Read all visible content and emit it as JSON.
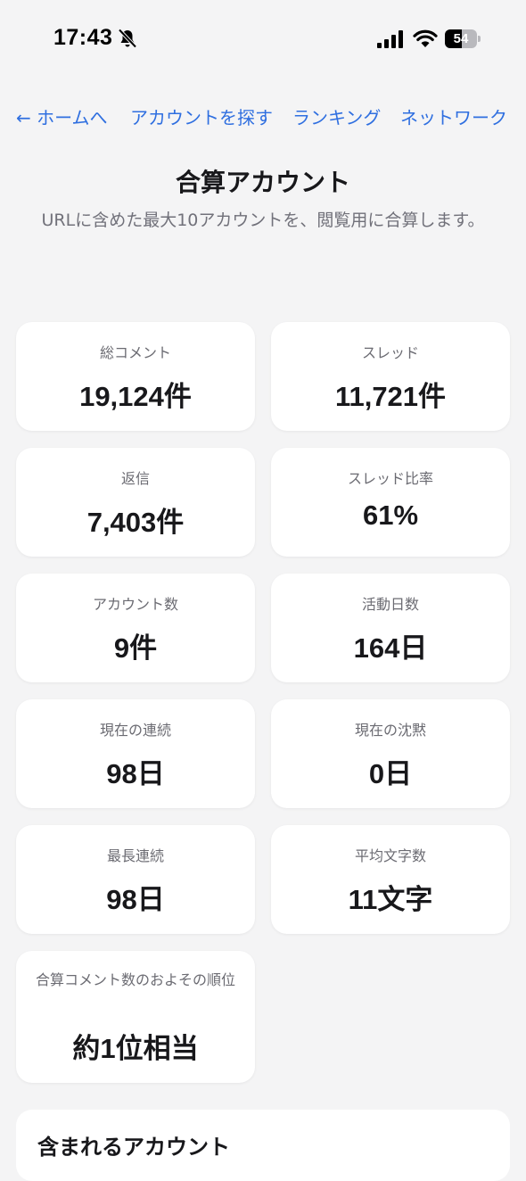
{
  "status": {
    "time": "17:43",
    "battery_level": "54",
    "battery_fraction": 0.54,
    "icons": [
      "bell-off-icon",
      "cellular-signal-icon",
      "wifi-icon",
      "battery-icon"
    ]
  },
  "nav": {
    "home": "← ホームへ",
    "find": "アカウントを探す",
    "ranking": "ランキング",
    "network": "ネットワーク"
  },
  "page": {
    "title": "合算アカウント",
    "subtitle": "URLに含めた最大10アカウントを、閲覧用に合算します。"
  },
  "stats": [
    {
      "label": "総コメント",
      "value": "19,124件"
    },
    {
      "label": "スレッド",
      "value": "11,721件"
    },
    {
      "label": "返信",
      "value": "7,403件"
    },
    {
      "label": "スレッド比率",
      "value": "61%"
    },
    {
      "label": "アカウント数",
      "value": "9件"
    },
    {
      "label": "活動日数",
      "value": "164日"
    },
    {
      "label": "現在の連続",
      "value": "98日"
    },
    {
      "label": "現在の沈黙",
      "value": "0日"
    },
    {
      "label": "最長連続",
      "value": "98日"
    },
    {
      "label": "平均文字数",
      "value": "11文字"
    },
    {
      "label": "合算コメント数のおよその順位",
      "value": "約1位相当"
    }
  ],
  "accounts_section": {
    "heading": "含まれるアカウント"
  },
  "colors": {
    "background": "#f4f4f5",
    "link": "#2f6fe0",
    "card": "#ffffff",
    "text": "#18181b",
    "muted": "#71717a"
  }
}
